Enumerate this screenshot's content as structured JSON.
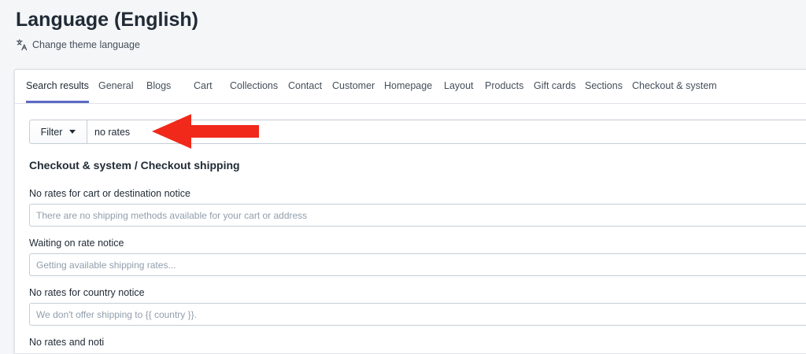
{
  "header": {
    "title": "Language (English)",
    "change_theme_language": "Change theme language"
  },
  "tabs": [
    {
      "label": "Search results",
      "active": true
    },
    {
      "label": "General"
    },
    {
      "label": "Blogs"
    },
    {
      "label": "Cart"
    },
    {
      "label": "Collections"
    },
    {
      "label": "Contact"
    },
    {
      "label": "Customer"
    },
    {
      "label": "Homepage"
    },
    {
      "label": "Layout"
    },
    {
      "label": "Products"
    },
    {
      "label": "Gift cards"
    },
    {
      "label": "Sections"
    },
    {
      "label": "Checkout & system"
    }
  ],
  "search": {
    "filter_label": "Filter",
    "value": "no rates"
  },
  "section": {
    "title": "Checkout & system / Checkout shipping",
    "fields": [
      {
        "label": "No rates for cart or destination notice",
        "placeholder": "There are no shipping methods available for your cart or address"
      },
      {
        "label": "Waiting on rate notice",
        "placeholder": "Getting available shipping rates..."
      },
      {
        "label": "No rates for country notice",
        "placeholder": "We don't offer shipping to {{ country }}."
      },
      {
        "label": "No rates and noti"
      }
    ]
  },
  "colors": {
    "accent": "#5c6ac4",
    "annotation_arrow": "#f0291a"
  },
  "icons": {
    "translate": "translate-icon",
    "caret": "caret-down-icon",
    "annotation": "red-arrow-annotation"
  }
}
